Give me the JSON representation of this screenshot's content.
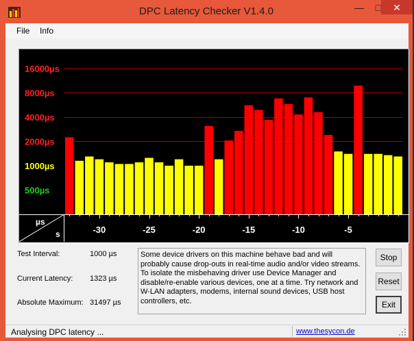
{
  "window": {
    "title": "DPC Latency Checker V1.4.0",
    "controls": {
      "minimize": "—",
      "maximize": "□",
      "close": "✕"
    },
    "icon": "bar-chart-icon"
  },
  "menu": {
    "items": [
      "File",
      "Info"
    ]
  },
  "chart_data": {
    "type": "bar",
    "x": [
      -33,
      -32,
      -31,
      -30,
      -29,
      -28,
      -27,
      -26,
      -25,
      -24,
      -23,
      -22,
      -21,
      -20,
      -19,
      -18,
      -17,
      -16,
      -15,
      -14,
      -13,
      -12,
      -11,
      -10,
      -9,
      -8,
      -7,
      -6,
      -5,
      -4,
      -3,
      -2,
      -1,
      0
    ],
    "values": [
      2250,
      1150,
      1300,
      1200,
      1100,
      1050,
      1050,
      1100,
      1250,
      1100,
      1000,
      1200,
      1000,
      1000,
      3100,
      1200,
      2050,
      2700,
      5600,
      4900,
      3700,
      6800,
      5800,
      4300,
      7000,
      4600,
      2400,
      1500,
      1400,
      9800,
      1400,
      1400,
      1350,
      1300
    ],
    "colors": [
      "#ff0000",
      "#ffff00",
      "#ffff00",
      "#ffff00",
      "#ffff00",
      "#ffff00",
      "#ffff00",
      "#ffff00",
      "#ffff00",
      "#ffff00",
      "#ffff00",
      "#ffff00",
      "#ffff00",
      "#ffff00",
      "#ff0000",
      "#ffff00",
      "#ff0000",
      "#ff0000",
      "#ff0000",
      "#ff0000",
      "#ff0000",
      "#ff0000",
      "#ff0000",
      "#ff0000",
      "#ff0000",
      "#ff0000",
      "#ff0000",
      "#ffff00",
      "#ffff00",
      "#ff0000",
      "#ffff00",
      "#ffff00",
      "#ffff00",
      "#ffff00"
    ],
    "y_scale": "log",
    "ylim": [
      250,
      25000
    ],
    "y_ticks": [
      {
        "value": 500,
        "label": "500µs",
        "color": "#22cc22"
      },
      {
        "value": 1000,
        "label": "1000µs",
        "color": "#ffff00"
      },
      {
        "value": 2000,
        "label": "2000µs",
        "color": "#ff2020"
      },
      {
        "value": 4000,
        "label": "4000µs",
        "color": "#ff2020"
      },
      {
        "value": 8000,
        "label": "8000µs",
        "color": "#ff2020"
      },
      {
        "value": 16000,
        "label": "16000µs",
        "color": "#ff2020"
      }
    ],
    "gridlines": [
      16000,
      8000,
      4000,
      2000
    ],
    "x_ticks": [
      -30,
      -25,
      -20,
      -15,
      -10,
      -5
    ],
    "x_tick_labels": [
      "-30",
      "-25",
      "-20",
      "-15",
      "-10",
      "-5"
    ],
    "y_unit": "µs",
    "x_unit": "s",
    "grid": true
  },
  "info": {
    "test_interval_label": "Test Interval:",
    "test_interval_value": "1000 µs",
    "current_latency_label": "Current Latency:",
    "current_latency_value": "1323 µs",
    "absolute_maximum_label": "Absolute Maximum:",
    "absolute_maximum_value": "31497 µs"
  },
  "message": "Some device drivers on this machine behave bad and will probably cause drop-outs in real-time audio and/or video streams. To isolate the misbehaving driver use Device Manager and disable/re-enable various devices, one at a time. Try network and W-LAN adapters, modems, internal sound devices, USB host controllers, etc.",
  "buttons": {
    "stop": "Stop",
    "reset": "Reset",
    "exit": "Exit"
  },
  "status": {
    "text": "Analysing DPC latency ...",
    "link": "www.thesycon.de"
  },
  "colors": {
    "title_bar": "#e8583a",
    "close_button": "#c7372a",
    "chart_background": "#000000",
    "bar_normal": "#ffff00",
    "bar_high": "#ff0000"
  }
}
